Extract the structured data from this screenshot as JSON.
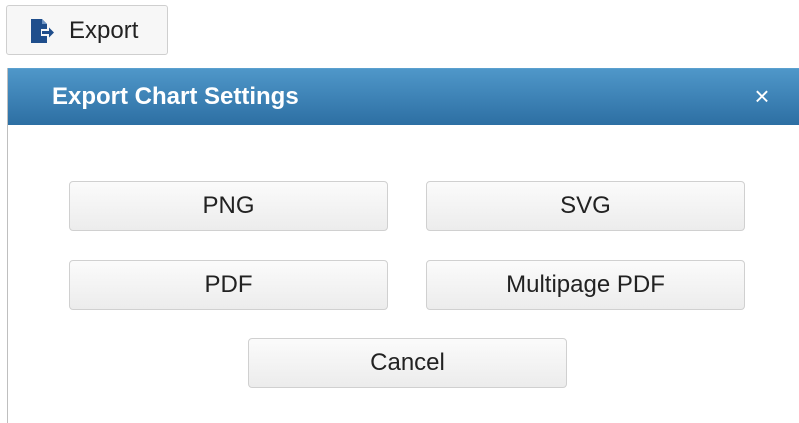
{
  "toolbar": {
    "export_label": "Export"
  },
  "dialog": {
    "title": "Export Chart Settings",
    "close_symbol": "×",
    "options": {
      "png": "PNG",
      "svg": "SVG",
      "pdf": "PDF",
      "multipage_pdf": "Multipage PDF"
    },
    "cancel_label": "Cancel"
  },
  "colors": {
    "header_top": "#4f97c9",
    "header_bottom": "#2d6fa3",
    "icon": "#1f4e8c"
  },
  "icons": {
    "export": "file-export-icon",
    "close": "close-icon"
  }
}
